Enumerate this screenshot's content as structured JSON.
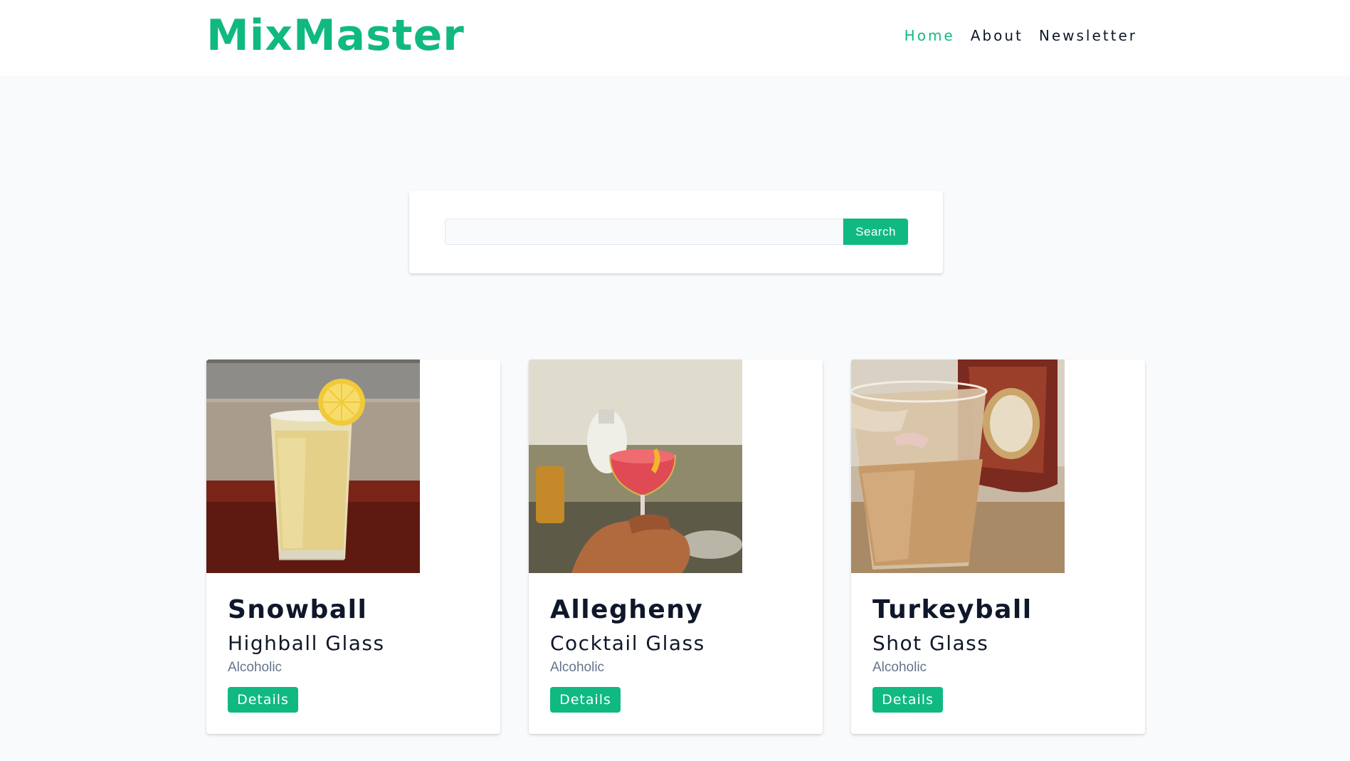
{
  "navbar": {
    "logo": "MixMaster",
    "links": [
      {
        "label": "Home",
        "active": true
      },
      {
        "label": "About",
        "active": false
      },
      {
        "label": "Newsletter",
        "active": false
      }
    ]
  },
  "search": {
    "value": "",
    "placeholder": "",
    "button_label": "Search"
  },
  "cocktails": [
    {
      "name": "Snowball",
      "glass": "Highball Glass",
      "info": "Alcoholic",
      "button_label": "Details",
      "image": "snowball-drink-photo"
    },
    {
      "name": "Allegheny",
      "glass": "Cocktail Glass",
      "info": "Alcoholic",
      "button_label": "Details",
      "image": "allegheny-drink-photo"
    },
    {
      "name": "Turkeyball",
      "glass": "Shot Glass",
      "info": "Alcoholic",
      "button_label": "Details",
      "image": "turkeyball-drink-photo"
    }
  ],
  "colors": {
    "accent": "#10b981",
    "page_background": "#f8fafc",
    "text": "#0f172a",
    "muted_text": "#64748b"
  }
}
